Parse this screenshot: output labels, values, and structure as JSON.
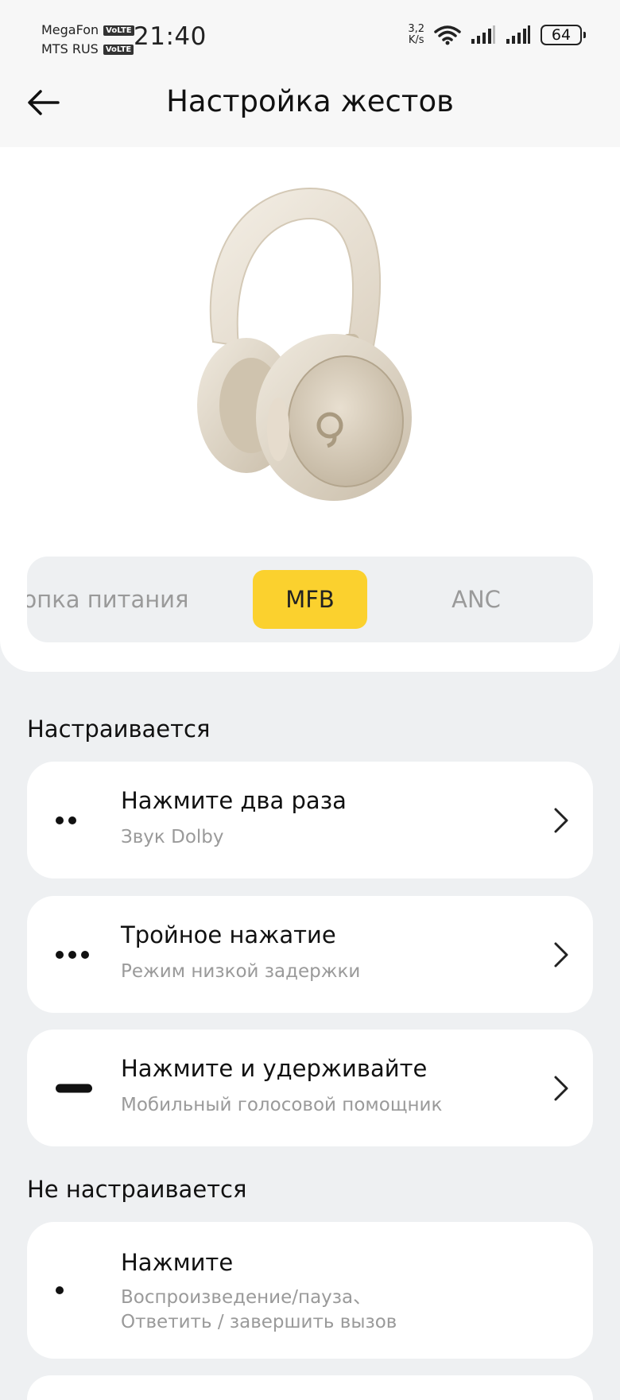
{
  "status_bar": {
    "carrier1": "MegaFon",
    "carrier2": "MTS RUS",
    "volte": "VoLTE",
    "time": "21:40",
    "net_speed_value": "3,2",
    "net_speed_unit": "K/s",
    "battery": "64"
  },
  "header": {
    "title": "Настройка жестов",
    "back_icon": "arrow-left-icon"
  },
  "product": {
    "image": "headphones-image"
  },
  "segments": {
    "items": [
      "опка питания",
      "MFB",
      "ANC"
    ],
    "selected": "MFB",
    "accent_color": "#fbd12e"
  },
  "configurable": {
    "title": "Настраивается",
    "items": [
      {
        "icon": "double-dot-icon",
        "title": "Нажмите два раза",
        "subtitle": "Звук Dolby"
      },
      {
        "icon": "triple-dot-icon",
        "title": "Тройное нажатие",
        "subtitle": "Режим низкой задержки"
      },
      {
        "icon": "long-press-icon",
        "title": "Нажмите и удерживайте",
        "subtitle": "Мобильный голосовой помощник"
      }
    ]
  },
  "non_configurable": {
    "title": "Не настраивается",
    "items": [
      {
        "icon": "single-dot-icon",
        "title": "Нажмите",
        "subtitle_line1": "Воспроизведение/пауза、",
        "subtitle_line2": "Ответить / завершить вызов"
      }
    ]
  }
}
